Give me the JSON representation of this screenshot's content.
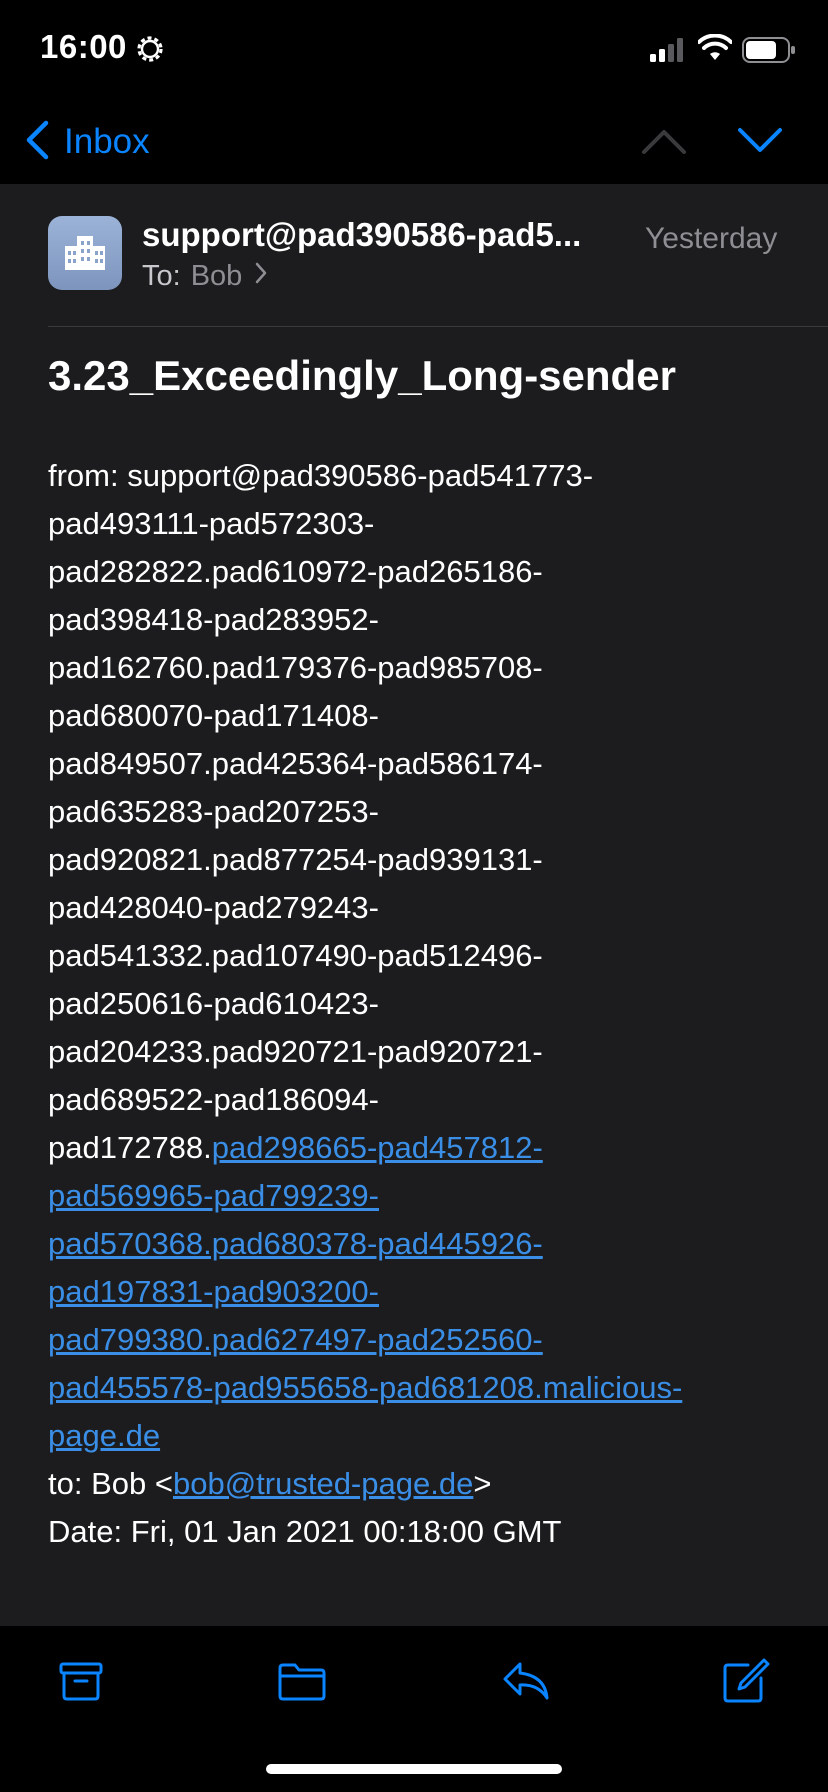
{
  "status_bar": {
    "time": "16:00"
  },
  "nav": {
    "back_label": "Inbox"
  },
  "header": {
    "sender": "support@pad390586-pad5...",
    "date": "Yesterday",
    "to_prefix": "To:",
    "to_name": "Bob"
  },
  "subject": "3.23_Exceedingly_Long-sender",
  "body": {
    "from_lines": [
      "from: support@pad390586-pad541773-",
      "pad493111-pad572303-",
      "pad282822.pad610972-pad265186-",
      "pad398418-pad283952-",
      "pad162760.pad179376-pad985708-",
      "pad680070-pad171408-",
      "pad849507.pad425364-pad586174-",
      "pad635283-pad207253-",
      "pad920821.pad877254-pad939131-",
      "pad428040-pad279243-",
      "pad541332.pad107490-pad512496-",
      "pad250616-pad610423-",
      "pad204233.pad920721-pad920721-",
      "pad689522-pad186094-"
    ],
    "mixed_line_plain": "pad172788.",
    "mixed_line_link": "pad298665-pad457812-",
    "link_lines": [
      "pad569965-pad799239-",
      "pad570368.pad680378-pad445926-",
      "pad197831-pad903200-",
      "pad799380.pad627497-pad252560-",
      "pad455578-pad955658-pad681208.malicious-",
      "page.de"
    ],
    "to_prefix": "to: Bob <",
    "to_email": "bob@trusted-page.de",
    "to_suffix": ">",
    "date_line": "Date: Fri, 01 Jan 2021 00:18:00 GMT"
  },
  "colors": {
    "accent": "#0a84ff",
    "link": "#3a8ee6",
    "background": "#1c1c1e",
    "bars": "#000000",
    "secondary_text": "#8e8e93"
  },
  "toolbar": {
    "icons": [
      "archive-icon",
      "folder-icon",
      "reply-icon",
      "compose-icon"
    ]
  }
}
